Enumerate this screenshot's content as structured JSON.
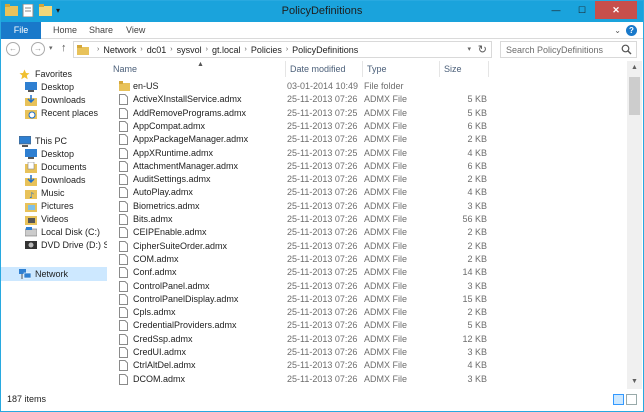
{
  "window": {
    "title": "PolicyDefinitions",
    "controls": {
      "minimize": "—",
      "maximize": "☐",
      "close": "✕"
    }
  },
  "ribbon": {
    "file_tab": "File",
    "tabs": [
      "Home",
      "Share",
      "View"
    ],
    "expand_glyph": "⌄",
    "help_glyph": "?"
  },
  "address_bar": {
    "back_glyph": "←",
    "forward_glyph": "→",
    "history_glyph": "▾",
    "up_glyph": "↑",
    "separator": "›",
    "crumbs": [
      "Network",
      "dc01",
      "sysvol",
      "gt.local",
      "Policies",
      "PolicyDefinitions"
    ],
    "refresh_glyph": "↻"
  },
  "search": {
    "placeholder": "Search PolicyDefinitions"
  },
  "nav_pane": {
    "favorites": {
      "label": "Favorites",
      "items": [
        "Desktop",
        "Downloads",
        "Recent places"
      ]
    },
    "this_pc": {
      "label": "This PC",
      "items": [
        "Desktop",
        "Documents",
        "Downloads",
        "Music",
        "Pictures",
        "Videos",
        "Local Disk (C:)",
        "DVD Drive (D:) SCCM"
      ]
    },
    "network": {
      "label": "Network"
    }
  },
  "columns": {
    "name": "Name",
    "date": "Date modified",
    "type": "Type",
    "size": "Size",
    "sort_glyph": "▲"
  },
  "files": [
    {
      "name": "en-US",
      "date": "03-01-2014 10:49",
      "type": "File folder",
      "size": "",
      "kind": "folder"
    },
    {
      "name": "ActiveXInstallService.admx",
      "date": "25-11-2013 07:26",
      "type": "ADMX File",
      "size": "5 KB",
      "kind": "file"
    },
    {
      "name": "AddRemovePrograms.admx",
      "date": "25-11-2013 07:25",
      "type": "ADMX File",
      "size": "5 KB",
      "kind": "file"
    },
    {
      "name": "AppCompat.admx",
      "date": "25-11-2013 07:26",
      "type": "ADMX File",
      "size": "6 KB",
      "kind": "file"
    },
    {
      "name": "AppxPackageManager.admx",
      "date": "25-11-2013 07:26",
      "type": "ADMX File",
      "size": "2 KB",
      "kind": "file"
    },
    {
      "name": "AppXRuntime.admx",
      "date": "25-11-2013 07:25",
      "type": "ADMX File",
      "size": "4 KB",
      "kind": "file"
    },
    {
      "name": "AttachmentManager.admx",
      "date": "25-11-2013 07:26",
      "type": "ADMX File",
      "size": "6 KB",
      "kind": "file"
    },
    {
      "name": "AuditSettings.admx",
      "date": "25-11-2013 07:26",
      "type": "ADMX File",
      "size": "2 KB",
      "kind": "file"
    },
    {
      "name": "AutoPlay.admx",
      "date": "25-11-2013 07:26",
      "type": "ADMX File",
      "size": "4 KB",
      "kind": "file"
    },
    {
      "name": "Biometrics.admx",
      "date": "25-11-2013 07:26",
      "type": "ADMX File",
      "size": "3 KB",
      "kind": "file"
    },
    {
      "name": "Bits.admx",
      "date": "25-11-2013 07:26",
      "type": "ADMX File",
      "size": "56 KB",
      "kind": "file"
    },
    {
      "name": "CEIPEnable.admx",
      "date": "25-11-2013 07:26",
      "type": "ADMX File",
      "size": "2 KB",
      "kind": "file"
    },
    {
      "name": "CipherSuiteOrder.admx",
      "date": "25-11-2013 07:26",
      "type": "ADMX File",
      "size": "2 KB",
      "kind": "file"
    },
    {
      "name": "COM.admx",
      "date": "25-11-2013 07:26",
      "type": "ADMX File",
      "size": "2 KB",
      "kind": "file"
    },
    {
      "name": "Conf.admx",
      "date": "25-11-2013 07:25",
      "type": "ADMX File",
      "size": "14 KB",
      "kind": "file"
    },
    {
      "name": "ControlPanel.admx",
      "date": "25-11-2013 07:26",
      "type": "ADMX File",
      "size": "3 KB",
      "kind": "file"
    },
    {
      "name": "ControlPanelDisplay.admx",
      "date": "25-11-2013 07:26",
      "type": "ADMX File",
      "size": "15 KB",
      "kind": "file"
    },
    {
      "name": "Cpls.admx",
      "date": "25-11-2013 07:26",
      "type": "ADMX File",
      "size": "2 KB",
      "kind": "file"
    },
    {
      "name": "CredentialProviders.admx",
      "date": "25-11-2013 07:26",
      "type": "ADMX File",
      "size": "5 KB",
      "kind": "file"
    },
    {
      "name": "CredSsp.admx",
      "date": "25-11-2013 07:26",
      "type": "ADMX File",
      "size": "12 KB",
      "kind": "file"
    },
    {
      "name": "CredUI.admx",
      "date": "25-11-2013 07:26",
      "type": "ADMX File",
      "size": "3 KB",
      "kind": "file"
    },
    {
      "name": "CtrlAltDel.admx",
      "date": "25-11-2013 07:26",
      "type": "ADMX File",
      "size": "4 KB",
      "kind": "file"
    },
    {
      "name": "DCOM.admx",
      "date": "25-11-2013 07:26",
      "type": "ADMX File",
      "size": "3 KB",
      "kind": "file"
    }
  ],
  "status": {
    "item_count": "187 items"
  },
  "colors": {
    "titlebar": "#1aa3dc",
    "file_tab": "#1979ca",
    "close": "#c74f4b",
    "selection": "#cde8ff",
    "folder": "#e8c25a"
  }
}
